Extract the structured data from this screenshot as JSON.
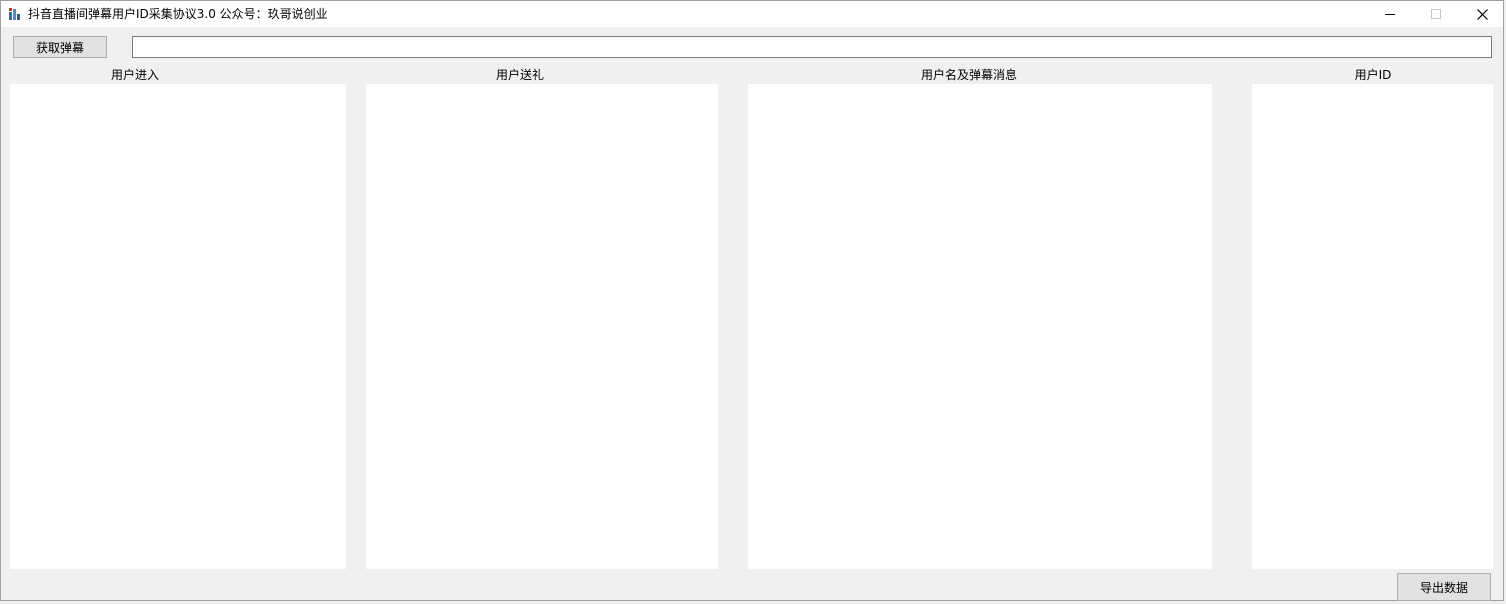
{
  "window": {
    "title": "抖音直播间弹幕用户ID采集协议3.0  公众号：玖哥说创业",
    "icon": "app-icon",
    "controls": {
      "minimize_icon": "minimize-icon",
      "maximize_icon": "maximize-icon",
      "close_icon": "close-icon"
    }
  },
  "toolbar": {
    "fetch_label": "获取弹幕",
    "url_value": ""
  },
  "columns": {
    "user_enter": "用户进入",
    "user_gift": "用户送礼",
    "user_message": "用户名及弹幕消息",
    "user_id": "用户ID"
  },
  "footer": {
    "export_label": "导出数据"
  }
}
